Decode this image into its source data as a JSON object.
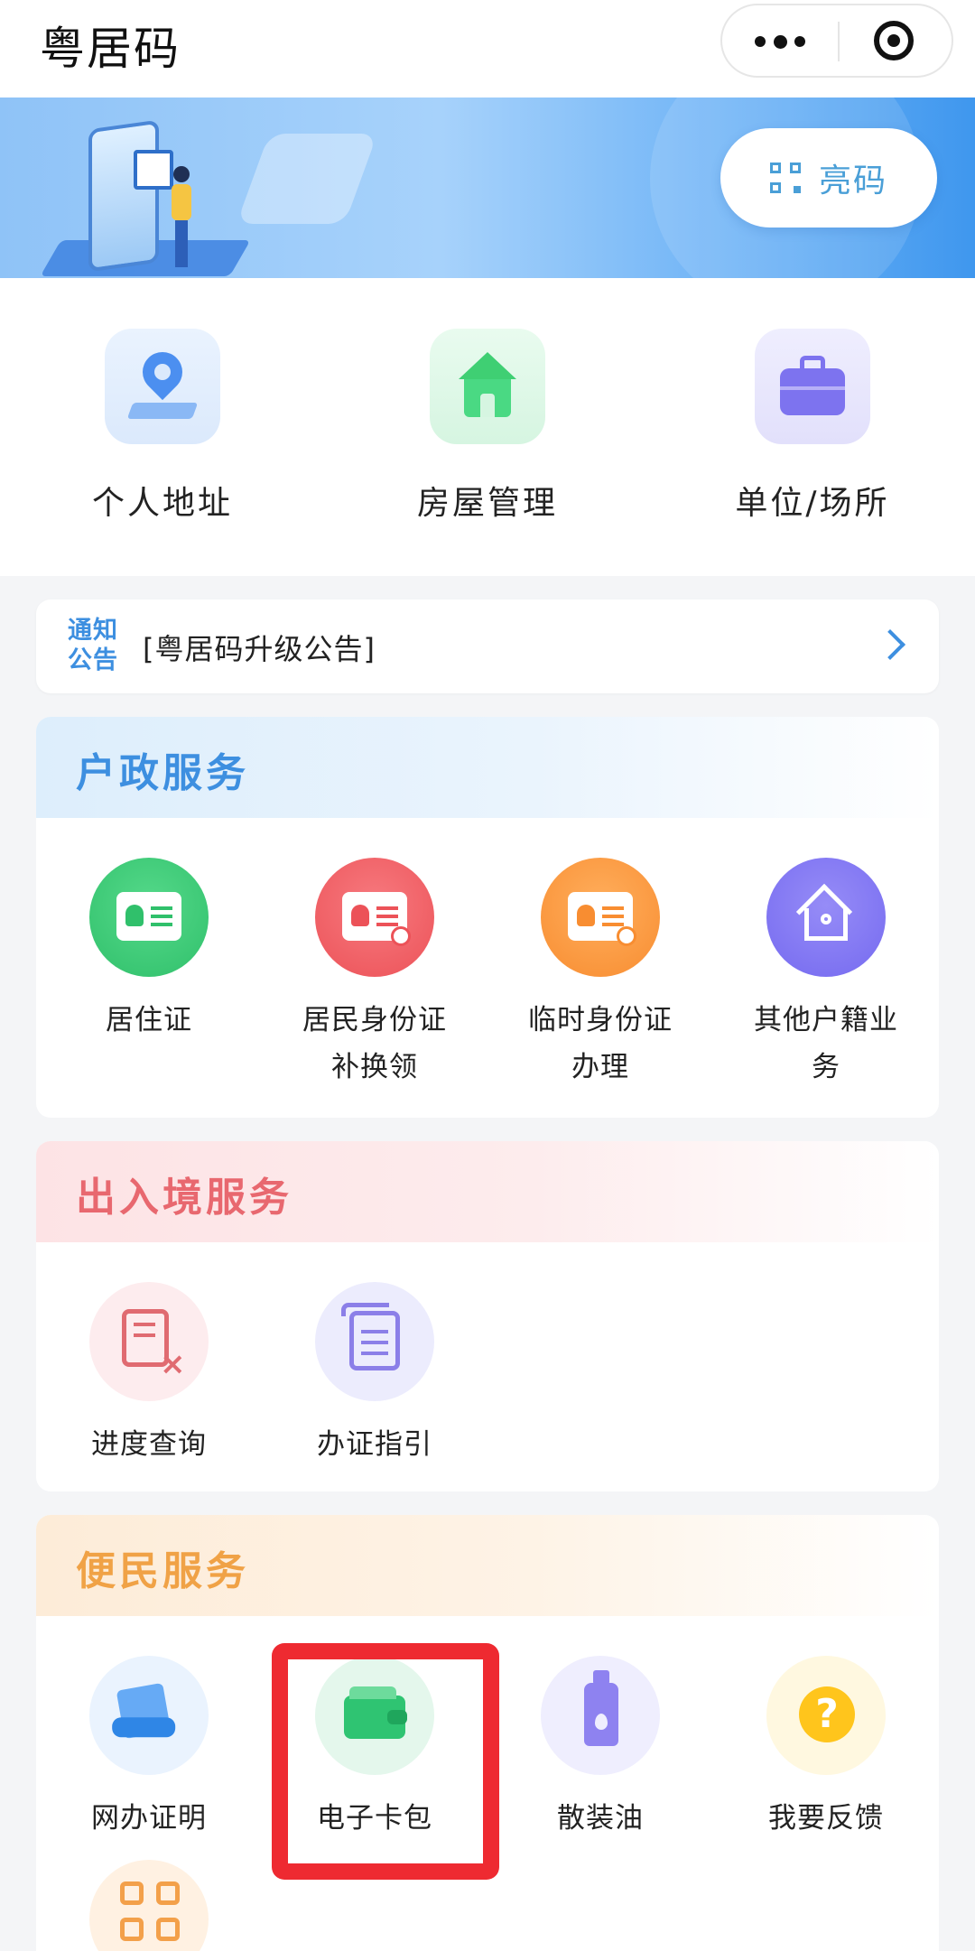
{
  "header": {
    "title": "粤居码"
  },
  "banner": {
    "show_code_label": "亮码"
  },
  "quick_entries": [
    {
      "label": "个人地址",
      "icon": "location-pin-icon",
      "color": "#4c8ff0"
    },
    {
      "label": "房屋管理",
      "icon": "house-icon",
      "color": "#3fcf73"
    },
    {
      "label": "单位/场所",
      "icon": "briefcase-icon",
      "color": "#7d73ef"
    }
  ],
  "notice": {
    "badge_line1": "通知",
    "badge_line2": "公告",
    "text": "[粤居码升级公告]"
  },
  "sections": {
    "household": {
      "title": "户政服务",
      "color": "#3d8fe0",
      "items": [
        {
          "line1": "居住证",
          "line2": "",
          "icon": "residence-permit-icon"
        },
        {
          "line1": "居民身份证",
          "line2": "补换领",
          "icon": "id-card-renew-icon"
        },
        {
          "line1": "临时身份证",
          "line2": "办理",
          "icon": "temporary-id-icon"
        },
        {
          "line1": "其他户籍业",
          "line2": "务",
          "icon": "household-registration-icon"
        }
      ]
    },
    "immigration": {
      "title": "出入境服务",
      "color": "#e8686f",
      "items": [
        {
          "label": "进度查询",
          "icon": "progress-query-icon"
        },
        {
          "label": "办证指引",
          "icon": "guide-document-icon"
        }
      ]
    },
    "convenience": {
      "title": "便民服务",
      "color": "#f0a246",
      "items": [
        {
          "label": "网办证明",
          "icon": "online-certificate-icon"
        },
        {
          "label": "电子卡包",
          "icon": "wallet-icon"
        },
        {
          "label": "散装油",
          "icon": "bulk-oil-icon"
        },
        {
          "label": "我要反馈",
          "icon": "feedback-icon"
        },
        {
          "label": "",
          "icon": "more-grid-icon"
        }
      ]
    }
  },
  "highlight": {
    "target": "电子卡包",
    "color": "#ee2a31"
  }
}
